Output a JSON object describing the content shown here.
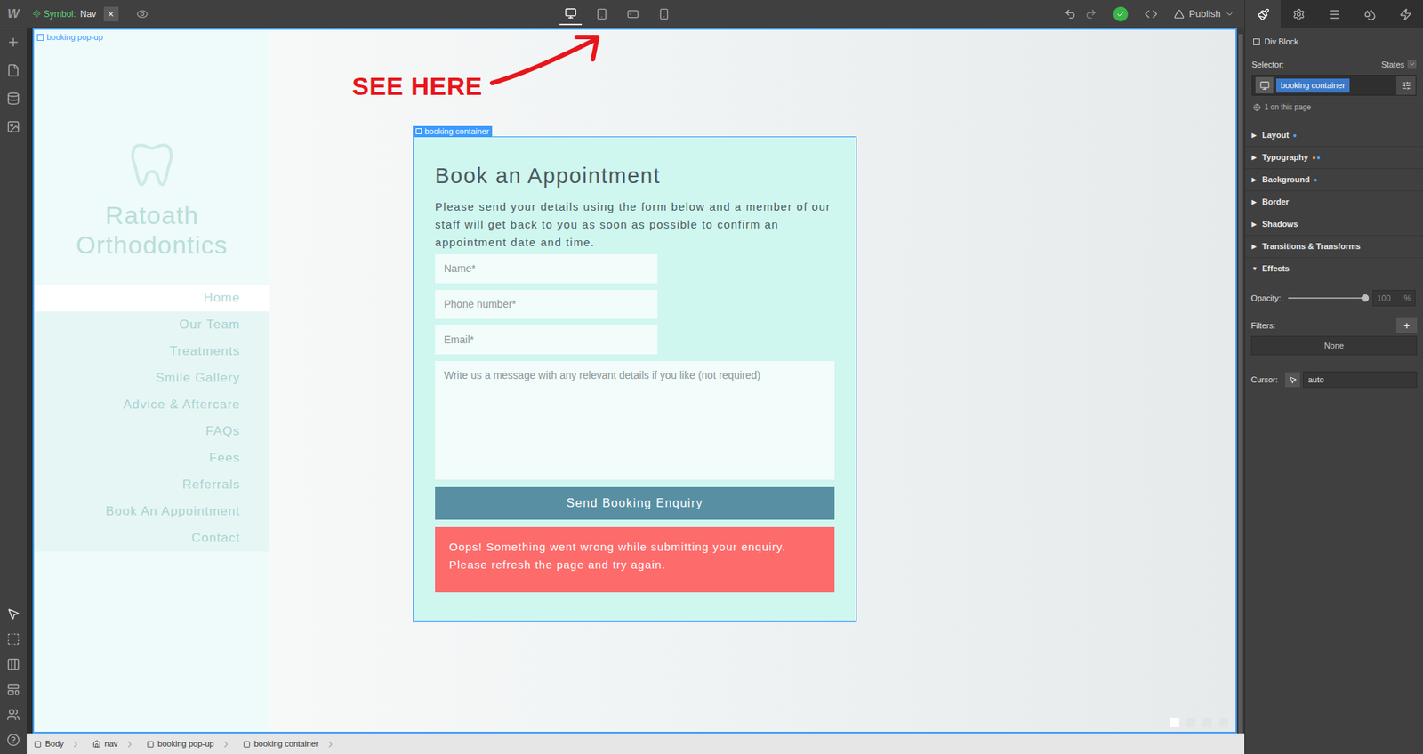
{
  "topbar": {
    "logo": "W",
    "symbol_label": "Symbol:",
    "symbol_name": "Nav",
    "close": "×",
    "devices": [
      {
        "kind": "desktop",
        "selected": true
      },
      {
        "kind": "tablet",
        "selected": false
      },
      {
        "kind": "landscape",
        "selected": false
      },
      {
        "kind": "portrait",
        "selected": false
      }
    ],
    "saved": true,
    "publish": "Publish"
  },
  "annotation": {
    "text": "SEE HERE",
    "color": "#e8151b"
  },
  "canvas": {
    "element_label": "booking pop-up",
    "site": {
      "title": "Ratoath Orthodontics",
      "nav": [
        {
          "label": "Home",
          "selected": true
        },
        {
          "label": "Our Team",
          "selected": false
        },
        {
          "label": "Treatments",
          "selected": false
        },
        {
          "label": "Smile Gallery",
          "selected": false
        },
        {
          "label": "Advice & Aftercare",
          "selected": false
        },
        {
          "label": "FAQs",
          "selected": false
        },
        {
          "label": "Fees",
          "selected": false
        },
        {
          "label": "Referrals",
          "selected": false
        },
        {
          "label": "Book An Appointment",
          "selected": false
        },
        {
          "label": "Contact",
          "selected": false
        }
      ]
    },
    "slider_dots": [
      {
        "selected": true
      },
      {
        "selected": false
      },
      {
        "selected": false
      },
      {
        "selected": false
      }
    ]
  },
  "booking": {
    "label": "booking container",
    "heading": "Book an Appointment",
    "text": "Please send your details using the form below and a member of our staff will get back to you as soon as possible to confirm an appointment date and time.",
    "fields": [
      {
        "kind": "input",
        "placeholder": "Name*"
      },
      {
        "kind": "input",
        "placeholder": "Phone number*"
      },
      {
        "kind": "input",
        "placeholder": "Email*"
      },
      {
        "kind": "textarea",
        "placeholder": "Write us a message with any relevant details if you like (not required)"
      }
    ],
    "button": "Send Booking Enquiry",
    "error": "Oops! Something went wrong while submitting your enquiry. Please refresh the page and try again."
  },
  "panel": {
    "tabs": [
      {
        "kind": "style",
        "selected": true
      },
      {
        "kind": "settings",
        "selected": false
      },
      {
        "kind": "navigator",
        "selected": false
      },
      {
        "kind": "swatches",
        "selected": false
      },
      {
        "kind": "interactions",
        "selected": false
      }
    ],
    "element_type": "Div Block",
    "selector_label": "Selector:",
    "states": "States",
    "selector": "booking container",
    "count": "1 on this page",
    "sections": [
      {
        "label": "Layout",
        "expanded": false,
        "dots": [
          "#4aa3ff"
        ]
      },
      {
        "label": "Typography",
        "expanded": false,
        "dots": [
          "#f0a030",
          "#4aa3ff"
        ]
      },
      {
        "label": "Background",
        "expanded": false,
        "dots": [
          "#4aa3ff"
        ]
      },
      {
        "label": "Border",
        "expanded": false,
        "dots": []
      },
      {
        "label": "Shadows",
        "expanded": false,
        "dots": []
      },
      {
        "label": "Transitions & Transforms",
        "expanded": false,
        "dots": []
      },
      {
        "label": "Effects",
        "expanded": true,
        "dots": []
      }
    ],
    "effects": {
      "opacity_label": "Opacity:",
      "opacity_level": 1,
      "opacity_value": "100",
      "opacity_unit": "%",
      "filters_label": "Filters:",
      "filters_add": "+",
      "filters_value": "None",
      "cursor_label": "Cursor:",
      "cursor_value": "auto"
    }
  },
  "breadcrumbs": [
    {
      "label": "Body",
      "kind": "element"
    },
    {
      "label": "nav",
      "kind": "symbol"
    },
    {
      "label": "booking pop-up",
      "kind": "element"
    },
    {
      "label": "booking container",
      "kind": "element"
    }
  ]
}
